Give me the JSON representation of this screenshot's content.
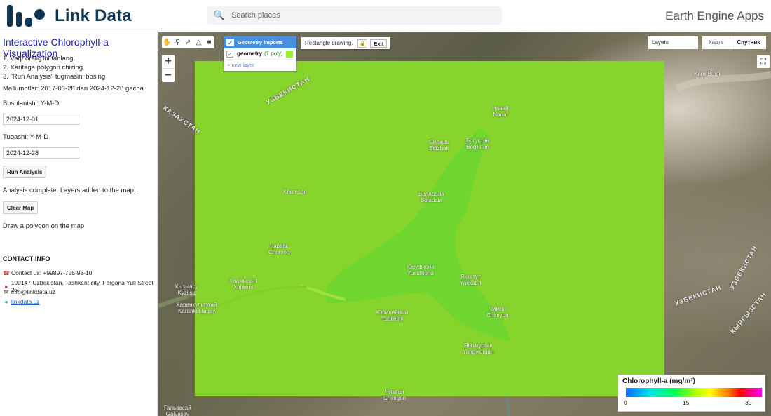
{
  "header": {
    "logo_text": "Link Data",
    "search_placeholder": "Search places",
    "app_title": "Earth Engine Apps"
  },
  "sidebar": {
    "title": "Interactive Chlorophyll-a Visualization",
    "steps": [
      "1. Vaqt oralig'ini tanlang.",
      "2. Xaritaga polygon chizing.",
      "3. \"Run Analysis\" tugmasini bosing"
    ],
    "data_range": "Ma'lumotlar: 2017-03-28 dan 2024-12-28 gacha",
    "start_label": "Boshlanishi: Y-M-D",
    "start_value": "2024-12-01",
    "end_label": "Tugashi: Y-M-D",
    "end_value": "2024-12-28",
    "run_button": "Run Analysis",
    "status": "Analysis complete. Layers added to the map.",
    "clear_button": "Clear Map",
    "hint": "Draw a polygon on the map",
    "contact_title": "CONTACT INFO",
    "contact_phone": "Contact us: +99897-755-98-10",
    "contact_address": "100147 Uzbekistan, Tashkent city, Fergana Yuli Street 25",
    "contact_email": "info@linkdata.uz",
    "contact_site": "linkdata.uz"
  },
  "map": {
    "geometry_imports": "Geometry Imports",
    "geometry_name": "geometry",
    "geometry_count": "(1 poly)",
    "new_layer": "+ new layer",
    "rect_drawing": "Rectangle drawing.",
    "exit": "Exit",
    "layers": "Layers",
    "map_type_map": "Карта",
    "map_type_satellite": "Спутник",
    "overlay_color": "#86d42c",
    "labels": {
      "kara_bulak": "Kara-Bulak",
      "nanai": "Нанай\nNanai",
      "sidzhak": "Сиджак\nSidzhak",
      "bogustan": "Богустан\nBog'iston",
      "khumsan": "Khumsan",
      "boladala": "Боладала\nBoladala",
      "chorvoq": "Чарвак\nChorvoq",
      "yusufkhona": "Юсуфхона\nYusufhona",
      "xojikent": "Ходжикент\nXojikent",
      "yakkatut": "Яккатут\nYakkatut",
      "kyzylsuv": "Кызылсу\nKyzilsu",
      "karankul": "Каранкультугай\nKarankul tugay",
      "yubileyniy": "Юбилейный\nYubileiny",
      "chimyon": "Чимён\nChimyon",
      "yangikurgan": "Янгикурган\nYangikurgan",
      "chimgon": "Чимган\nChimgon",
      "galvasay": "Гальвасай\nGalvasay",
      "kazakhstan": "КАЗАХСТАН",
      "uzbekistan_left": "УЗБЕКИСТАН",
      "uzbekistan_right": "УЗБЕКИСТАН",
      "kyrgyzstan": "КЫРГЫЗСТАН",
      "uzbekistan_right2": "УЗБЕКИСТАН"
    }
  },
  "legend": {
    "title": "Chlorophyll-a (mg/m³)",
    "ticks": [
      "0",
      "15",
      "30"
    ],
    "colors": [
      "#0a6cff",
      "#00e6e6",
      "#00ff55",
      "#b8ff00",
      "#ffff00",
      "#ff7f00",
      "#ff0000",
      "#ff00ff"
    ]
  }
}
